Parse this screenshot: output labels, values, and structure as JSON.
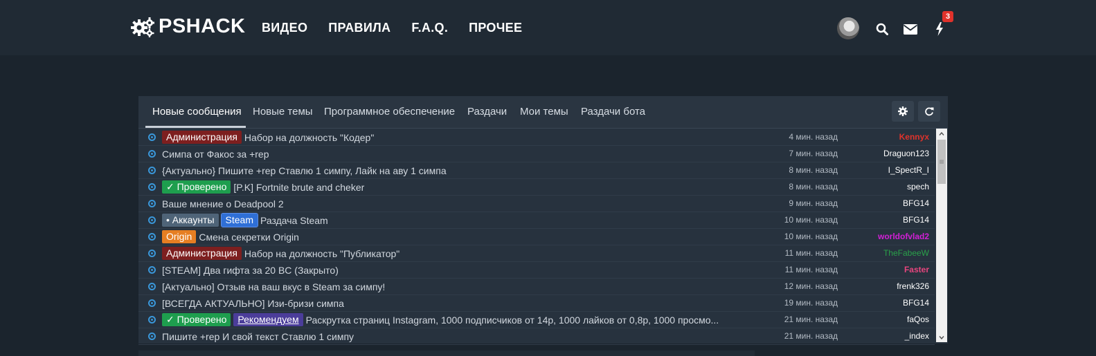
{
  "header": {
    "logo_text": "PSHACK",
    "nav": [
      "ВИДЕО",
      "ПРАВИЛА",
      "F.A.Q.",
      "ПРОЧЕЕ"
    ],
    "notification_count": "3",
    "icons": [
      "gears-icon",
      "avatar",
      "search-icon",
      "envelope-icon",
      "bolt-icon"
    ]
  },
  "tabs": {
    "items": [
      "Новые сообщения",
      "Новые темы",
      "Программное обеспечение",
      "Раздачи",
      "Мои темы",
      "Раздачи бота"
    ],
    "active": "Новые сообщения",
    "buttons": [
      "gear-icon",
      "refresh-icon"
    ]
  },
  "threads": [
    {
      "badges": [
        {
          "text": "Администрация",
          "color": "#7d1f1f"
        }
      ],
      "title": "Набор на должность \"Кодер\"",
      "time": "4 мин. назад",
      "user": "Kennyx",
      "user_color": "#e0322b"
    },
    {
      "badges": [],
      "title": "Симпа от Факос за +rep",
      "time": "7 мин. назад",
      "user": "Draguon123",
      "user_color": "#ffffff"
    },
    {
      "badges": [],
      "title": "{Актуально} Пишите +rep Ставлю 1 симпу, Лайк на аву 1 симпа",
      "time": "8 мин. назад",
      "user": "I_SpectR_I",
      "user_color": "#ffffff"
    },
    {
      "badges": [
        {
          "text": "✓ Проверено",
          "color": "#1e9e4e"
        }
      ],
      "title": "[P.K] Fortnite brute and cheker",
      "time": "8 мин. назад",
      "user": "spech",
      "user_color": "#ffffff"
    },
    {
      "badges": [],
      "title": "Ваше мнение о Deadpool 2",
      "time": "9 мин. назад",
      "user": "BFG14",
      "user_color": "#ffffff"
    },
    {
      "badges": [
        {
          "text": "• Аккаунты",
          "color": "#4f6478"
        },
        {
          "text": "Steam",
          "color": "#2f6fd6"
        }
      ],
      "title": "Раздача Steam",
      "time": "10 мин. назад",
      "user": "BFG14",
      "user_color": "#ffffff"
    },
    {
      "badges": [
        {
          "text": "Origin",
          "color": "#e67e22"
        }
      ],
      "title": "Смена секретки Origin",
      "time": "10 мин. назад",
      "user": "worldofvlad2",
      "user_color": "#d21fd6"
    },
    {
      "badges": [
        {
          "text": "Администрация",
          "color": "#7d1f1f"
        }
      ],
      "title": "Набор на должность \"Публикатор\"",
      "time": "11 мин. назад",
      "user": "TheFabeeW",
      "user_color": "#2aa14a"
    },
    {
      "badges": [],
      "title": "[STEAM] Два гифта за 20 BC (Закрыто)",
      "time": "11 мин. назад",
      "user": "Faster",
      "user_color": "#e8457e"
    },
    {
      "badges": [],
      "title": "[Актуально] Отзыв на ваш вкус в Steam за симпу!",
      "time": "12 мин. назад",
      "user": "frenk326",
      "user_color": "#ffffff"
    },
    {
      "badges": [],
      "title": "[ВСЕГДА АКТУАЛЬНО] Изи-бризи симпа",
      "time": "19 мин. назад",
      "user": "BFG14",
      "user_color": "#ffffff"
    },
    {
      "badges": [
        {
          "text": "✓ Проверено",
          "color": "#1e9e4e"
        },
        {
          "text": "Рекомендуем",
          "color": "#4b3d9a"
        }
      ],
      "title": "Раскрутка страниц Instagram, 1000 подписчиков от 14р, 1000 лайков от 0,8р, 1000 просмо...",
      "time": "21 мин. назад",
      "user": "faQos",
      "user_color": "#ffffff"
    },
    {
      "badges": [],
      "title": "Пишите +rep И свой текст Ставлю 1 симпу",
      "time": "21 мин. назад",
      "user": "_index",
      "user_color": "#ffffff"
    }
  ],
  "colors": {
    "page_bg": "#1b242d",
    "header_bg": "#202a34",
    "panel_bg": "#27323e",
    "accent_blue": "#3a97d9",
    "notification_red": "#e0322b"
  }
}
